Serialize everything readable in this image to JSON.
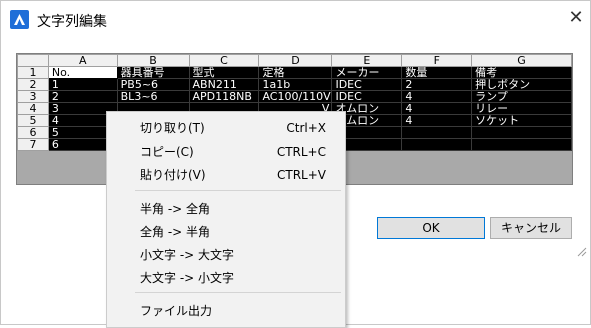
{
  "window": {
    "title": "文字列編集",
    "close_glyph": "✕"
  },
  "grid": {
    "columns": [
      "A",
      "B",
      "C",
      "D",
      "E",
      "F",
      "G"
    ],
    "rows": [
      {
        "num": "1",
        "cells": [
          "No.",
          "器具番号",
          "型式",
          "定格",
          "メーカー",
          "数量",
          "備考"
        ]
      },
      {
        "num": "2",
        "cells": [
          "1",
          "PB5~6",
          "ABN211",
          "1a1b",
          "IDEC",
          "2",
          "押しボタン"
        ]
      },
      {
        "num": "3",
        "cells": [
          "2",
          "BL3~6",
          "APD118NB",
          "AC100/110V",
          "IDEC",
          "4",
          "ランプ"
        ]
      },
      {
        "num": "4",
        "cells": [
          "3",
          "",
          "",
          "V",
          "オムロン",
          "4",
          "リレー"
        ]
      },
      {
        "num": "5",
        "cells": [
          "4",
          "",
          "",
          "",
          "オムロン",
          "4",
          "ソケット"
        ]
      },
      {
        "num": "6",
        "cells": [
          "5",
          "",
          "",
          "",
          "",
          "",
          ""
        ]
      },
      {
        "num": "7",
        "cells": [
          "6",
          "",
          "",
          "",
          "",
          "",
          ""
        ]
      }
    ]
  },
  "buttons": {
    "ok": "OK",
    "cancel": "キャンセル"
  },
  "context_menu": {
    "cut": {
      "label": "切り取り(T)",
      "shortcut": "Ctrl+X"
    },
    "copy": {
      "label": "コピー(C)",
      "shortcut": "CTRL+C"
    },
    "paste": {
      "label": "貼り付け(V)",
      "shortcut": "CTRL+V"
    },
    "half_to_full": {
      "label": "半角 -> 全角"
    },
    "full_to_half": {
      "label": "全角 -> 半角"
    },
    "lower_to_upper": {
      "label": "小文字 -> 大文字"
    },
    "upper_to_lower": {
      "label": "大文字 -> 小文字"
    },
    "file_output": {
      "label": "ファイル出力"
    }
  },
  "colors": {
    "accent": "#0078d7",
    "app_icon": "#1e6ed8",
    "cell_background": "#000000"
  }
}
